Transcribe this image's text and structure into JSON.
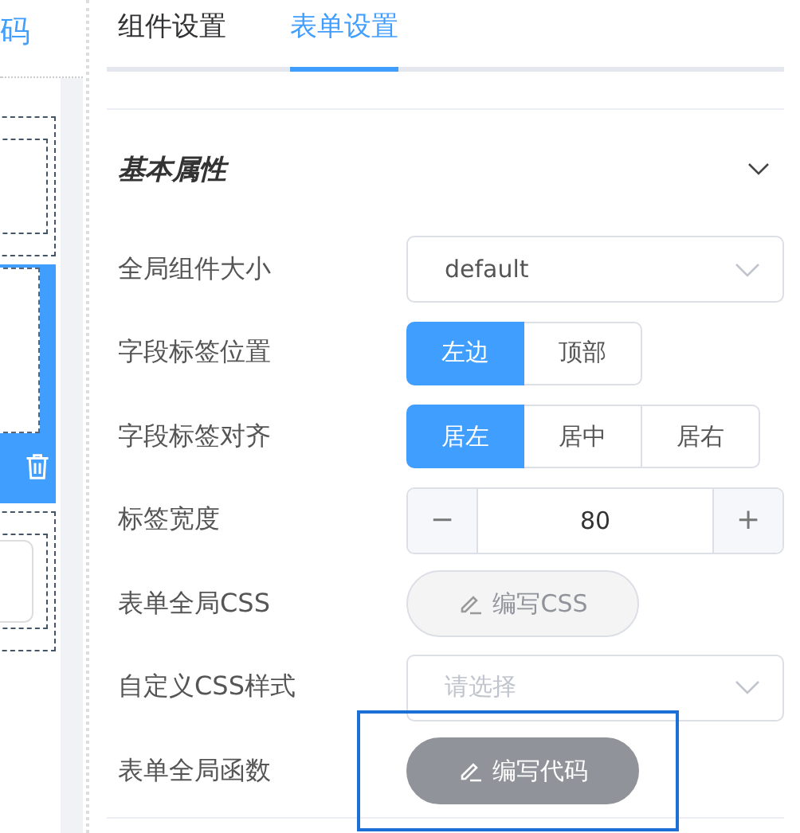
{
  "left_panel": {
    "header_text": "码",
    "widgets": [
      {
        "kind": "plain",
        "selected": false
      },
      {
        "kind": "plain",
        "selected": true
      },
      {
        "kind": "input",
        "selected": false
      }
    ]
  },
  "tabs": [
    {
      "label": "组件设置",
      "selected": false
    },
    {
      "label": "表单设置",
      "selected": true
    }
  ],
  "section": {
    "title": "基本属性",
    "expanded": true
  },
  "fields": [
    {
      "label": "全局组件大小",
      "kind": "select",
      "value": "default"
    },
    {
      "label": "字段标签位置",
      "kind": "radio",
      "options": [
        {
          "label": "左边",
          "selected": true
        },
        {
          "label": "顶部",
          "selected": false
        }
      ]
    },
    {
      "label": "字段标签对齐",
      "kind": "radio",
      "options": [
        {
          "label": "居左",
          "selected": true
        },
        {
          "label": "居中",
          "selected": false
        },
        {
          "label": "居右",
          "selected": false
        }
      ]
    },
    {
      "label": "标签宽度",
      "kind": "number",
      "value": "80",
      "minus": "−",
      "plus": "+"
    },
    {
      "label": "表单全局CSS",
      "kind": "button",
      "button": "编写CSS",
      "hovered": false
    },
    {
      "label": "自定义CSS样式",
      "kind": "select",
      "placeholder": "请选择"
    },
    {
      "label": "表单全局函数",
      "kind": "button",
      "button": "编写代码",
      "hovered": true,
      "highlighted": true
    }
  ]
}
